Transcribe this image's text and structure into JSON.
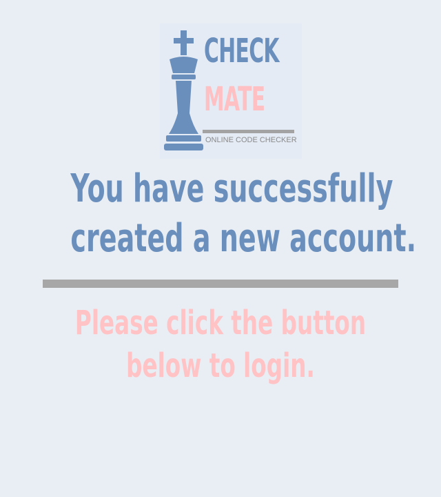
{
  "logo": {
    "title_top": "CHECK",
    "title_bottom": "MATE",
    "tagline": "ONLINE CODE CHECKER",
    "icon": "chess-king-icon",
    "colors": {
      "blue": "#6b8fbd",
      "pink": "#ffc0c3",
      "rule": "#a3a3a3"
    }
  },
  "message": {
    "headline_line1": "You have successfully",
    "headline_line2": "created a new account.",
    "instruction_line1": "Please click the button",
    "instruction_line2": "below to login."
  },
  "colors": {
    "background": "#e9eef4",
    "headline": "#6b8fbd",
    "instruction": "#ffc3c6",
    "divider": "#a7a7a7"
  }
}
